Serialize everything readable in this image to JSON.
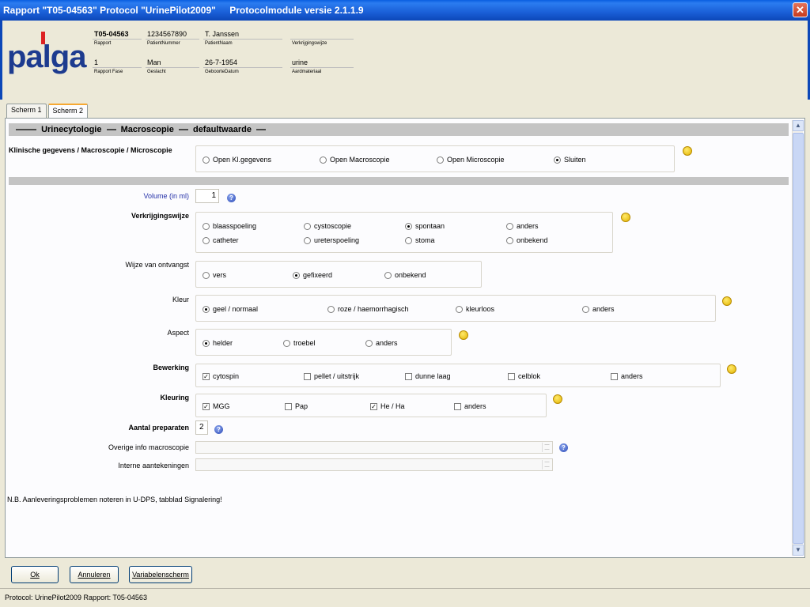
{
  "window": {
    "title_parts": [
      "Rapport \"T05-04563\" Protocol \"UrinePilot2009\"",
      "Protocolmodule versie 2.1.1.9"
    ],
    "close_glyph": "✕"
  },
  "logo": {
    "text": "palga"
  },
  "header": {
    "fields": [
      {
        "value": "T05-04563",
        "label": "Rapport"
      },
      {
        "value": "1234567890",
        "label": "PatientNummer"
      },
      {
        "value": "T. Janssen",
        "label": "PatientNaam"
      },
      {
        "value": "",
        "label": "Verkrijgingswijze"
      },
      {
        "value": "1",
        "label": "Rapport Fase"
      },
      {
        "value": "Man",
        "label": "Geslacht"
      },
      {
        "value": "26-7-1954",
        "label": "GeboorteDatum"
      },
      {
        "value": "urine",
        "label": "Aardmateriaal"
      }
    ]
  },
  "tabs": [
    {
      "label": "Scherm 1",
      "active": false
    },
    {
      "label": "Scherm 2",
      "active": true
    }
  ],
  "section_title": [
    "Urinecytologie",
    "Macroscopie",
    "defaultwaarde"
  ],
  "form": {
    "klinische": {
      "label": "Klinische gegevens / Macroscopie / Microscopie",
      "options": [
        {
          "label": "Open Kl.gegevens",
          "selected": false
        },
        {
          "label": "Open Macroscopie",
          "selected": false
        },
        {
          "label": "Open Microscopie",
          "selected": false
        },
        {
          "label": "Sluiten",
          "selected": true
        }
      ]
    },
    "volume": {
      "label": "Volume (in ml)",
      "value": "1"
    },
    "verkrijgingswijze": {
      "label": "Verkrijgingswijze",
      "options": [
        {
          "label": "blaasspoeling",
          "selected": false
        },
        {
          "label": "cystoscopie",
          "selected": false
        },
        {
          "label": "spontaan",
          "selected": true
        },
        {
          "label": "anders",
          "selected": false
        },
        {
          "label": "catheter",
          "selected": false
        },
        {
          "label": "ureterspoeling",
          "selected": false
        },
        {
          "label": "stoma",
          "selected": false
        },
        {
          "label": "onbekend",
          "selected": false
        }
      ]
    },
    "ontvangst": {
      "label": "Wijze van ontvangst",
      "options": [
        {
          "label": "vers",
          "selected": false
        },
        {
          "label": "gefixeerd",
          "selected": true
        },
        {
          "label": "onbekend",
          "selected": false
        }
      ]
    },
    "kleur": {
      "label": "Kleur",
      "options": [
        {
          "label": "geel / normaal",
          "selected": true
        },
        {
          "label": "roze / haemorrhagisch",
          "selected": false
        },
        {
          "label": "kleurloos",
          "selected": false
        },
        {
          "label": "anders",
          "selected": false
        }
      ]
    },
    "aspect": {
      "label": "Aspect",
      "options": [
        {
          "label": "helder",
          "selected": true
        },
        {
          "label": "troebel",
          "selected": false
        },
        {
          "label": "anders",
          "selected": false
        }
      ]
    },
    "bewerking": {
      "label": "Bewerking",
      "options": [
        {
          "label": "cytospin",
          "checked": true
        },
        {
          "label": "pellet / uitstrijk",
          "checked": false
        },
        {
          "label": "dunne laag",
          "checked": false
        },
        {
          "label": "celblok",
          "checked": false
        },
        {
          "label": "anders",
          "checked": false
        }
      ]
    },
    "kleuring": {
      "label": "Kleuring",
      "options": [
        {
          "label": "MGG",
          "checked": true
        },
        {
          "label": "Pap",
          "checked": false
        },
        {
          "label": "He / Ha",
          "checked": true
        },
        {
          "label": "anders",
          "checked": false
        }
      ]
    },
    "aantal": {
      "label": "Aantal preparaten",
      "value": "2"
    },
    "overige": {
      "label": "Overige info macroscopie",
      "value": ""
    },
    "interne": {
      "label": "Interne aantekeningen",
      "value": ""
    },
    "note": "N.B. Aanleveringsproblemen noteren in U-DPS, tabblad Signalering!"
  },
  "buttons": {
    "ok": "Ok",
    "annuleren": "Annuleren",
    "variabelenscherm": "Variabelenscherm"
  },
  "status": "Protocol: UrinePilot2009  Rapport: T05-04563",
  "icons": {
    "help_glyph": "?",
    "scroll_up": "▲",
    "scroll_down": "▼",
    "check_glyph": "✓"
  }
}
